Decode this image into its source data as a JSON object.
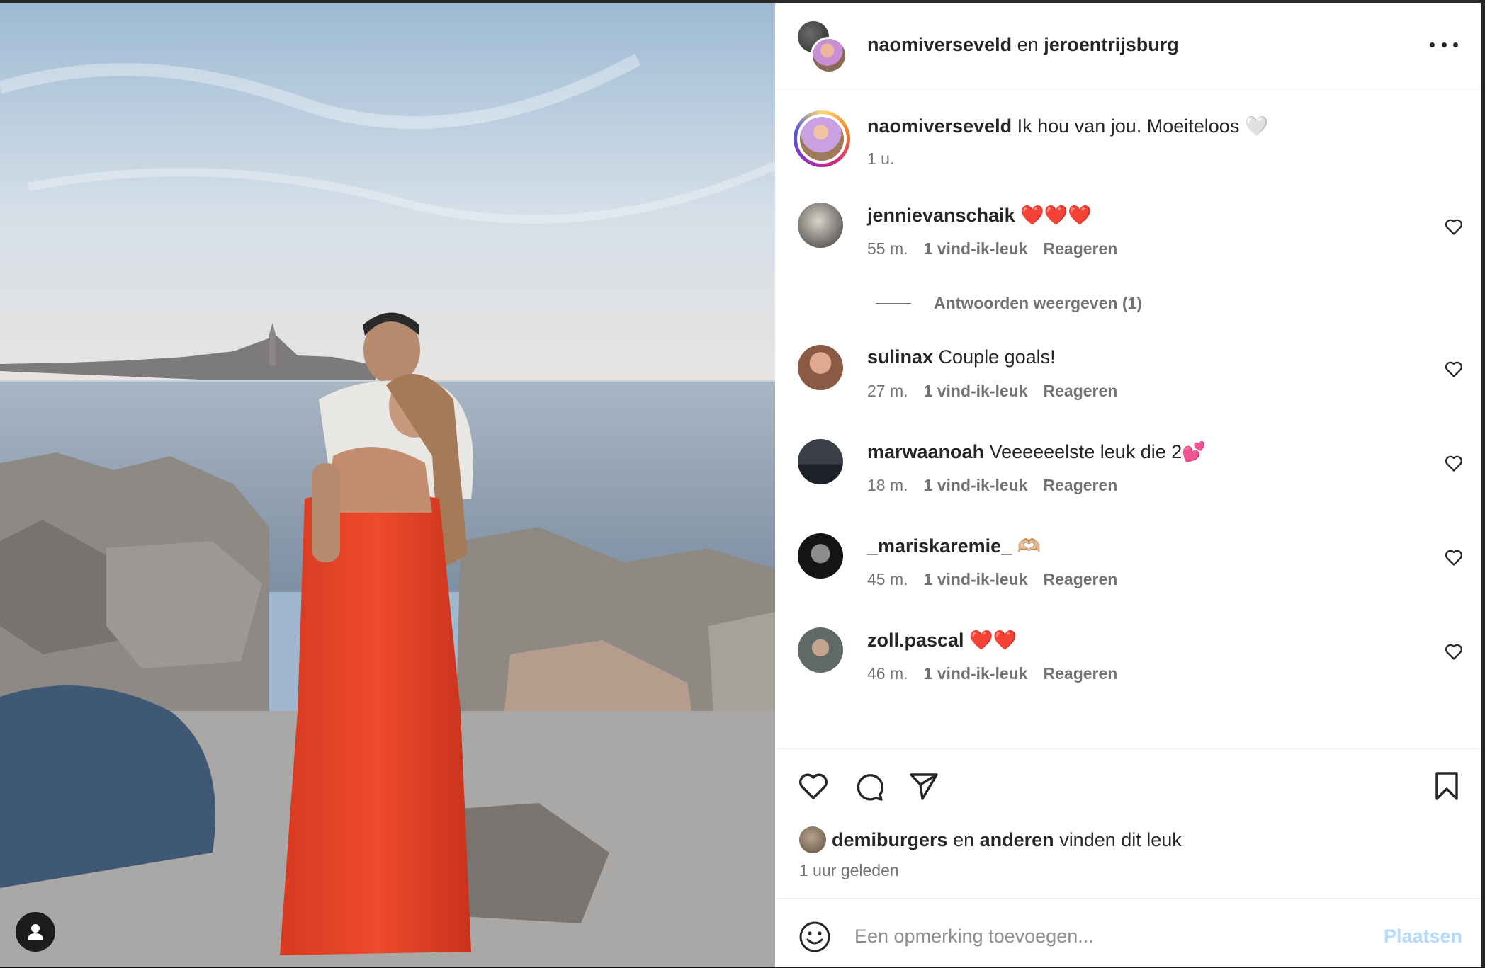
{
  "header": {
    "user1": "naomiverseveld",
    "conjunction": "en",
    "user2": "jeroentrijsburg"
  },
  "caption": {
    "username": "naomiverseveld",
    "text": "Ik hou van jou. Moeiteloos 🤍",
    "time": "1 u."
  },
  "comments": [
    {
      "username": "jennievanschaik",
      "text": "❤️❤️❤️",
      "time": "55 m.",
      "likes": "1 vind-ik-leuk",
      "reply": "Reageren"
    },
    {
      "username": "sulinax",
      "text": "Couple goals!",
      "time": "27 m.",
      "likes": "1 vind-ik-leuk",
      "reply": "Reageren"
    },
    {
      "username": "marwaanoah",
      "text": "Veeeeeelste leuk die 2💕",
      "time": "18 m.",
      "likes": "1 vind-ik-leuk",
      "reply": "Reageren"
    },
    {
      "username": "_mariskaremie_",
      "text": "🫶🏼",
      "time": "45 m.",
      "likes": "1 vind-ik-leuk",
      "reply": "Reageren"
    },
    {
      "username": "zoll.pascal",
      "text": "❤️❤️",
      "time": "46 m.",
      "likes": "1 vind-ik-leuk",
      "reply": "Reageren"
    }
  ],
  "replies_toggle": "Antwoorden weergeven (1)",
  "likes_summary": {
    "user": "demiburgers",
    "conj": "en",
    "others": "anderen",
    "suffix": "vinden dit leuk"
  },
  "time_ago": "1 uur geleden",
  "add_comment": {
    "placeholder": "Een opmerking toevoegen...",
    "post_label": "Plaatsen"
  },
  "colors": {
    "text": "#262626",
    "secondary": "#737373",
    "post_disabled": "#b3dbff",
    "dress": "#e8432a"
  }
}
